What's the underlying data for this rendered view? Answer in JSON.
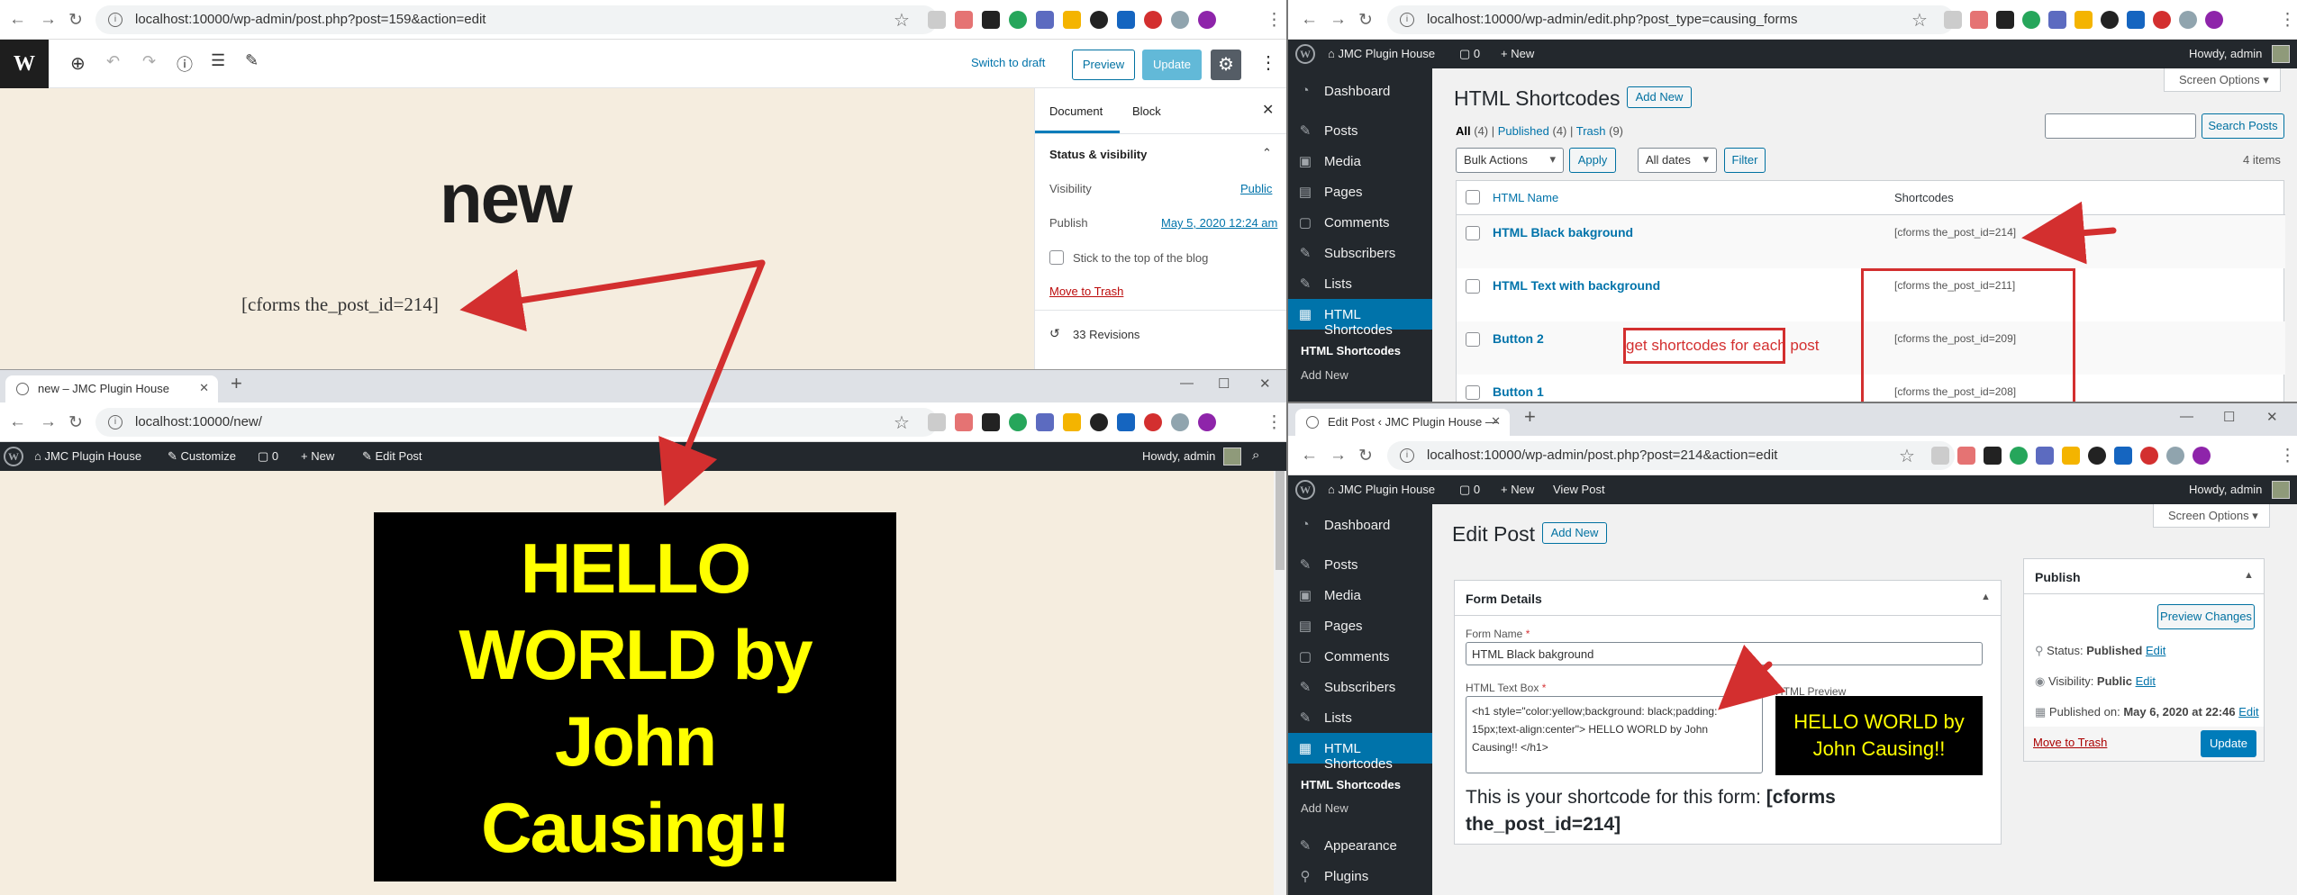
{
  "editor": {
    "url": "localhost:10000/wp-admin/post.php?post=159&action=edit",
    "switch_draft": "Switch to draft",
    "preview": "Preview",
    "update": "Update",
    "title": "new",
    "shortcode": "[cforms the_post_id=214]",
    "tab_document": "Document",
    "tab_block": "Block",
    "status_heading": "Status & visibility",
    "visibility_label": "Visibility",
    "visibility_value": "Public",
    "publish_label": "Publish",
    "publish_value": "May 5, 2020 12:24 am",
    "stick_label": "Stick to the top of the blog",
    "trash": "Move to Trash",
    "revisions": "33 Revisions"
  },
  "frontend": {
    "tab_title": "new – JMC Plugin House",
    "url": "localhost:10000/new/",
    "adminbar": {
      "site": "JMC Plugin House",
      "customize": "Customize",
      "comments": "0",
      "new": "New",
      "edit_post": "Edit Post",
      "howdy": "Howdy, admin"
    },
    "hero_lines": [
      "HELLO",
      "WORLD by",
      "John",
      "Causing!!"
    ]
  },
  "list": {
    "url": "localhost:10000/wp-admin/edit.php?post_type=causing_forms",
    "adminbar": {
      "site": "JMC Plugin House",
      "comments": "0",
      "new": "New",
      "howdy": "Howdy, admin"
    },
    "screen_options": "Screen Options",
    "page_title": "HTML Shortcodes",
    "add_new": "Add New",
    "filter_all": "All",
    "filter_all_count": "(4)",
    "filter_published": "Published",
    "filter_published_count": "(4)",
    "filter_trash": "Trash",
    "filter_trash_count": "(9)",
    "search_button": "Search Posts",
    "bulk_actions": "Bulk Actions",
    "apply": "Apply",
    "all_dates": "All dates",
    "filter": "Filter",
    "items_count": "4 items",
    "col_name": "HTML Name",
    "col_shortcodes": "Shortcodes",
    "rows": [
      {
        "name": "HTML Black bakground",
        "shortcode": "[cforms the_post_id=214]"
      },
      {
        "name": "HTML Text with background",
        "shortcode": "[cforms the_post_id=211]"
      },
      {
        "name": "Button 2",
        "shortcode": "[cforms the_post_id=209]"
      },
      {
        "name": "Button 1",
        "shortcode": "[cforms the_post_id=208]"
      }
    ],
    "annotation": "get shortcodes for each post",
    "menu": {
      "dashboard": "Dashboard",
      "posts": "Posts",
      "media": "Media",
      "pages": "Pages",
      "comments": "Comments",
      "subscribers": "Subscribers",
      "lists": "Lists",
      "html_shortcodes": "HTML Shortcodes",
      "sub_html_shortcodes": "HTML Shortcodes",
      "sub_add_new": "Add New"
    }
  },
  "edit": {
    "tab_title": "Edit Post ‹ JMC Plugin House —",
    "url": "localhost:10000/wp-admin/post.php?post=214&action=edit",
    "adminbar": {
      "site": "JMC Plugin House",
      "comments": "0",
      "new": "New",
      "view_post": "View Post",
      "howdy": "Howdy, admin"
    },
    "screen_options": "Screen Options",
    "page_title": "Edit Post",
    "add_new": "Add New",
    "form_details": "Form Details",
    "form_name_label": "Form Name",
    "form_name_value": "HTML Black bakground",
    "textbox_label": "HTML Text Box",
    "textbox_value": "<h1 style=\"color:yellow;background: black;padding: 15px;text-align:center\"> HELLO WORLD by John Causing!! </h1>",
    "preview_label": "HTML Preview",
    "preview_text": "HELLO WORLD by John Causing!!",
    "shortcode_prefix": "This is your shortcode for this form: ",
    "shortcode_value": "[cforms the_post_id=214]",
    "publish_heading": "Publish",
    "preview_changes": "Preview Changes",
    "status_label": "Status: ",
    "status_value": "Published",
    "visibility_label": "Visibility: ",
    "visibility_value": "Public",
    "published_on_label": "Published on: ",
    "published_on_value": "May 6, 2020 at 22:46",
    "edit_link": "Edit",
    "move_to_trash": "Move to Trash",
    "update": "Update",
    "menu": {
      "dashboard": "Dashboard",
      "posts": "Posts",
      "media": "Media",
      "pages": "Pages",
      "comments": "Comments",
      "subscribers": "Subscribers",
      "lists": "Lists",
      "html_shortcodes": "HTML Shortcodes",
      "sub_html_shortcodes": "HTML Shortcodes",
      "sub_add_new": "Add New",
      "appearance": "Appearance",
      "plugins": "Plugins"
    }
  },
  "colors": {
    "wp_blue": "#0073aa",
    "admin_dark": "#23282d",
    "hero_yellow": "#ffff00",
    "annotation_red": "#d32f2f",
    "editor_bg": "#f5eddf"
  }
}
